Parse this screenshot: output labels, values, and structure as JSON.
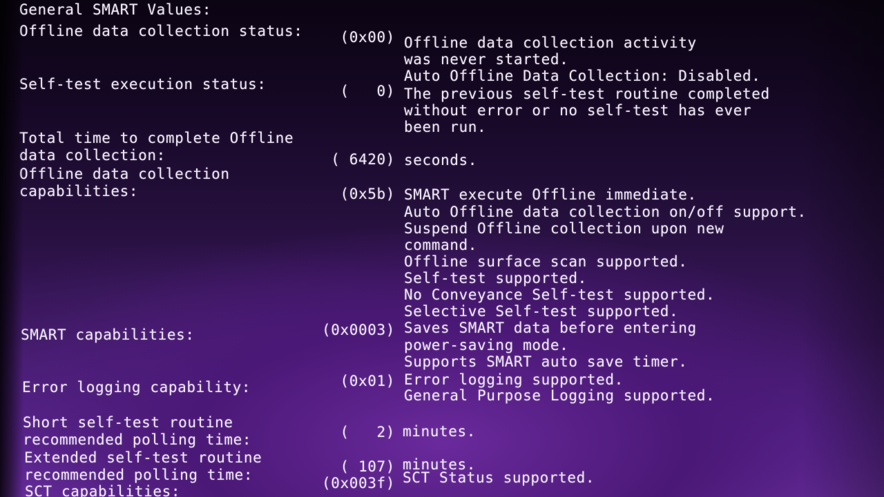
{
  "section_title": "General SMART Values:",
  "entries": {
    "offline_status": {
      "label": "Offline data collection status:",
      "code": "(0x00)",
      "desc": [
        "Offline data collection activity",
        "was never started.",
        "Auto Offline Data Collection: Disabled."
      ]
    },
    "self_test_status": {
      "label": "Self-test execution status:",
      "code": "(   0)",
      "desc": [
        "The previous self-test routine completed",
        "without error or no self-test has ever",
        "been run."
      ]
    },
    "total_time": {
      "label": [
        "Total time to complete Offline",
        "data collection:"
      ],
      "code": "( 6420)",
      "desc": [
        "seconds."
      ]
    },
    "offline_caps": {
      "label": [
        "Offline data collection",
        "capabilities:"
      ],
      "code": "(0x5b)",
      "desc": [
        "SMART execute Offline immediate.",
        "Auto Offline data collection on/off support.",
        "Suspend Offline collection upon new",
        "command.",
        "Offline surface scan supported.",
        "Self-test supported.",
        "No Conveyance Self-test supported.",
        "Selective Self-test supported."
      ]
    },
    "smart_caps": {
      "label": "SMART capabilities:",
      "code": "(0x0003)",
      "desc": [
        "Saves SMART data before entering",
        "power-saving mode.",
        "Supports SMART auto save timer."
      ]
    },
    "error_logging": {
      "label": "Error logging capability:",
      "code": "(0x01)",
      "desc": [
        "Error logging supported.",
        "General Purpose Logging supported."
      ]
    },
    "short_selftest": {
      "label": [
        "Short self-test routine",
        "recommended polling time:"
      ],
      "code": "(   2)",
      "desc": [
        "minutes."
      ]
    },
    "extended_selftest": {
      "label": [
        "Extended self-test routine",
        "recommended polling time:"
      ],
      "code": "( 107)",
      "desc": [
        "minutes."
      ]
    },
    "sct_caps": {
      "label": "SCT capabilities:",
      "code": "(0x003f)",
      "desc": [
        "SCT Status supported."
      ]
    }
  }
}
